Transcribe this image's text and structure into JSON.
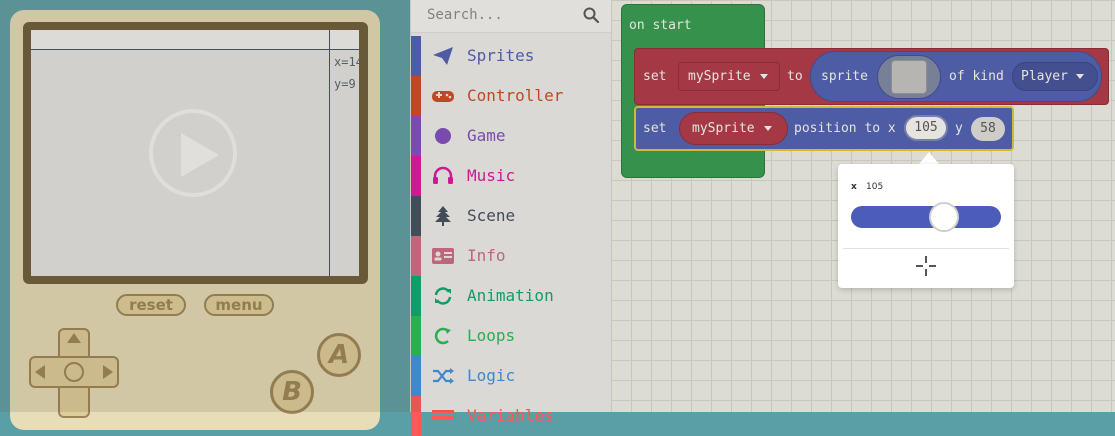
{
  "simulator": {
    "coord_x": "x=14",
    "coord_y": "y=9",
    "reset_label": "reset",
    "menu_label": "menu",
    "a_label": "A",
    "b_label": "B"
  },
  "toolbox": {
    "search_placeholder": "Search...",
    "categories": [
      {
        "label": "Sprites",
        "color": "#4b5db8",
        "icon": "paper-plane-icon"
      },
      {
        "label": "Controller",
        "color": "#d54322",
        "icon": "gamepad-icon"
      },
      {
        "label": "Game",
        "color": "#8049c1",
        "icon": "circle-icon"
      },
      {
        "label": "Music",
        "color": "#e40ea3",
        "icon": "headphones-icon"
      },
      {
        "label": "Scene",
        "color": "#404a5e",
        "icon": "tree-icon"
      },
      {
        "label": "Info",
        "color": "#cf6a87",
        "icon": "id-card-icon"
      },
      {
        "label": "Animation",
        "color": "#03aa74",
        "icon": "refresh-icon"
      },
      {
        "label": "Loops",
        "color": "#20bf55",
        "icon": "loop-icon"
      },
      {
        "label": "Logic",
        "color": "#3c91e6",
        "icon": "shuffle-icon"
      },
      {
        "label": "Variables",
        "color": "#ff5757",
        "icon": "list-icon"
      }
    ]
  },
  "blocks": {
    "on_start": "on start",
    "set": "set",
    "my_sprite": "mySprite",
    "to": "to",
    "sprite": "sprite",
    "of_kind": "of kind",
    "kind": "Player",
    "set2": "set",
    "my_sprite2": "mySprite",
    "position_to_x": "position to x",
    "x_value": "105",
    "y_label": "y",
    "y_value": "58"
  },
  "popup": {
    "field_name": "x",
    "field_value": "105",
    "slider_fraction": 0.62
  },
  "colors": {
    "sprites": "#4b5db8",
    "loops_green": "#2f9d4f",
    "sprite_var_red": "#b23447",
    "selection_yellow": "#e4cc38"
  }
}
